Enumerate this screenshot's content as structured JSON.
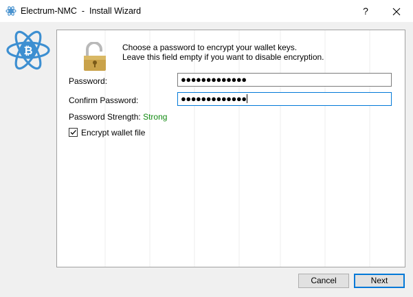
{
  "window": {
    "title": "Electrum-NMC  -  Install Wizard",
    "help_label": "?",
    "accent_color": "#0078d7"
  },
  "icons": {
    "app": "electrum-bitcoin-logo",
    "lock": "open-padlock-icon",
    "close": "close-icon"
  },
  "intro": {
    "line1": "Choose a password to encrypt your wallet keys.",
    "line2": "Leave this field empty if you want to disable encryption."
  },
  "form": {
    "password_label": "Password:",
    "password_value": "●●●●●●●●●●●●●",
    "confirm_label": "Confirm Password:",
    "confirm_value": "●●●●●●●●●●●●●",
    "strength_label": "Password Strength:",
    "strength_value": "Strong",
    "strength_color": "#118a11",
    "encrypt_label": "Encrypt wallet file",
    "encrypt_checked": true
  },
  "buttons": {
    "cancel": "Cancel",
    "next": "Next"
  }
}
